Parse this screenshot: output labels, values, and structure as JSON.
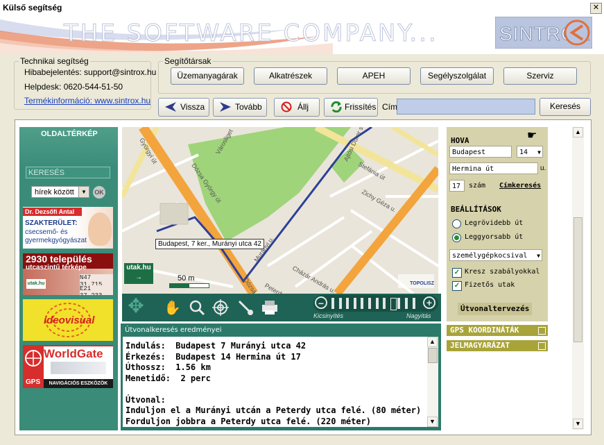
{
  "window": {
    "title": "Külső segítség",
    "close": "✕"
  },
  "banner": {
    "tagline": "THE SOFTWARE COMPANY...",
    "logo": "SINTROX"
  },
  "tech": {
    "legend": "Technikai segítség",
    "bug_report": "Hibabejelentés: support@sintrox.hu",
    "helpdesk": "Helpdesk: 0620-544-51-50",
    "product_info": "Termékinformáció: www.sintrox.hu"
  },
  "partners": {
    "legend": "Segítőtársak",
    "buttons": [
      "Üzemanyagárak",
      "Alkatrészek",
      "APEH",
      "Segélyszolgálat",
      "Szerviz"
    ]
  },
  "nav": {
    "back": "Vissza",
    "forward": "Tovább",
    "stop": "Állj",
    "refresh": "Frissítés",
    "address_label": "Cím",
    "address_value": "",
    "search": "Keresés"
  },
  "sidebar": {
    "title": "OLDALTÉRKÉP",
    "search_placeholder": "KERESÉS",
    "scope": "hírek között",
    "ok": "OK",
    "ad1": {
      "name": "Dr. Dezsőfi Antal",
      "heading": "SZAKTERÜLET:",
      "line1": "csecsemő- és",
      "line2": "gyermekgyógyászat"
    },
    "ad2": {
      "line1": "2930 település",
      "line2": "utcaszintű térképe",
      "coord1": "N47 31.715",
      "coord2": "E21 37.233",
      "badge": "utak.hu"
    },
    "ad3": {
      "text": "ideovisual"
    },
    "ad4": {
      "brand": "WorldGate",
      "gps": "GPS",
      "tagline": "NAVIGÁCIÓS ESZKÖZÖK"
    }
  },
  "map": {
    "tooltip": "Budapest, 7 ker., Murányi utca 42",
    "scale": "50 m",
    "logo": "utak.hu",
    "topolisz": "TOPOLISZ",
    "streets": [
      "Györgyi út",
      "Dózsa György út",
      "Városliget",
      "Ajtósi Dürer sor",
      "Stefánia út",
      "Zichy Géza u.",
      "Cházár András u.",
      "Peterdy u.",
      "Murányi u.",
      "Dózsa"
    ],
    "zoom_out": "Kicsinyítés",
    "zoom_in": "Nagyítás",
    "zoom_level": 0.72
  },
  "results": {
    "title": "Útvonalkeresés eredményei",
    "lines": [
      "Indulás:  Budapest 7 Murányi utca 42",
      "Érkezés:  Budapest 14 Hermina út 17",
      "Úthossz:  1.56 km",
      "Menetidő:  2 perc",
      "",
      "Útvonal:",
      "Induljon el a Murányi utcán a Peterdy utca felé. (80 méter)",
      "Forduljon jobbra a Peterdy utca felé. (220 méter)"
    ]
  },
  "route": {
    "hova": "HOVA",
    "city": "Budapest",
    "district": "14",
    "street": "Hermina út",
    "street_suffix": "u.",
    "number": "17",
    "number_label": "szám",
    "label_search": "Címkeresés",
    "settings": "BEÁLLÍTÁSOK",
    "shortest": "Legrövidebb út",
    "fastest": "Leggyorsabb út",
    "vehicle": "személygépkocsival",
    "kresz": "Kresz szabályokkal",
    "toll": "Fizetős utak",
    "plan": "Útvonaltervezés",
    "gps": "GPS KOORDINÁTÁK",
    "legend": "JELMAGYARÁZAT"
  }
}
